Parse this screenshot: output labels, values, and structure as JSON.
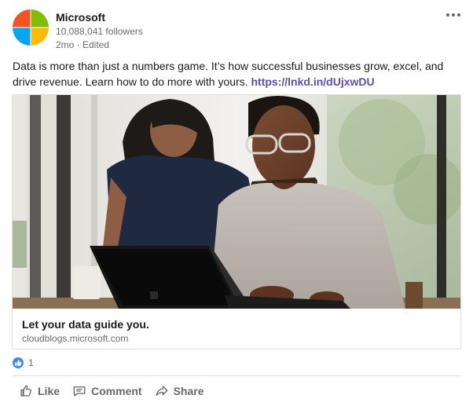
{
  "post": {
    "author": {
      "name": "Microsoft",
      "followers": "10,088,041 followers",
      "meta": "2mo · Edited"
    },
    "text": "Data is more than just a numbers game. It’s how successful businesses grow, excel, and drive revenue. Learn how to do more with yours. ",
    "link": "https://lnkd.in/dUjxwDU"
  },
  "card": {
    "title": "Let your data guide you.",
    "domain": "cloudblogs.microsoft.com"
  },
  "reactions": {
    "count": "1"
  },
  "actions": {
    "like": "Like",
    "comment": "Comment",
    "share": "Share"
  },
  "colors": {
    "ms_red": "#f35325",
    "ms_green": "#81bc06",
    "ms_blue": "#05a6f0",
    "ms_yellow": "#ffba08",
    "link": "#5a4fb8",
    "like_blue": "#378fe9"
  },
  "icons": {
    "more": "ellipsis-icon",
    "like": "thumbs-up-icon",
    "comment": "comment-icon",
    "share": "share-arrow-icon",
    "reaction": "like-reaction-icon"
  }
}
